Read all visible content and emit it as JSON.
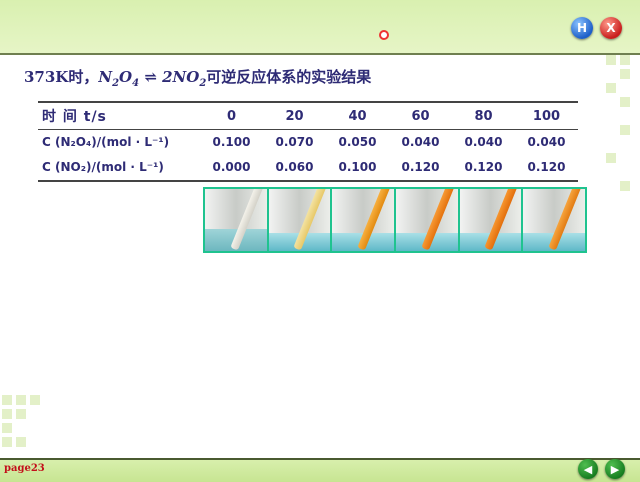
{
  "header": {
    "home_button": "H",
    "close_button": "X"
  },
  "title": {
    "prefix": "373K时，",
    "reactant": "N",
    "reactant_sub1": "2",
    "reactant_o": "O",
    "reactant_sub2": "4",
    "arrow": " ⇌ ",
    "product_coef": "2",
    "product": "NO",
    "product_sub": "2",
    "suffix": "可逆反应体系的实验结果"
  },
  "table": {
    "header_label": "时 间 t/s",
    "times": [
      "0",
      "20",
      "40",
      "60",
      "80",
      "100"
    ],
    "rows": [
      {
        "label": "C (N₂O₄)/(mol · L⁻¹)",
        "values": [
          "0.100",
          "0.070",
          "0.050",
          "0.040",
          "0.040",
          "0.040"
        ]
      },
      {
        "label": "C (NO₂)/(mol · L⁻¹)",
        "values": [
          "0.000",
          "0.060",
          "0.100",
          "0.120",
          "0.120",
          "0.120"
        ]
      }
    ]
  },
  "footer": {
    "page_label": "page23",
    "prev_icon": "◀",
    "next_icon": "▶"
  },
  "colors": {
    "title_color": "#2e2b75",
    "band_green": "#d9f0b0",
    "strip_border": "#1fc38f",
    "page_label_color": "#c3101a"
  }
}
